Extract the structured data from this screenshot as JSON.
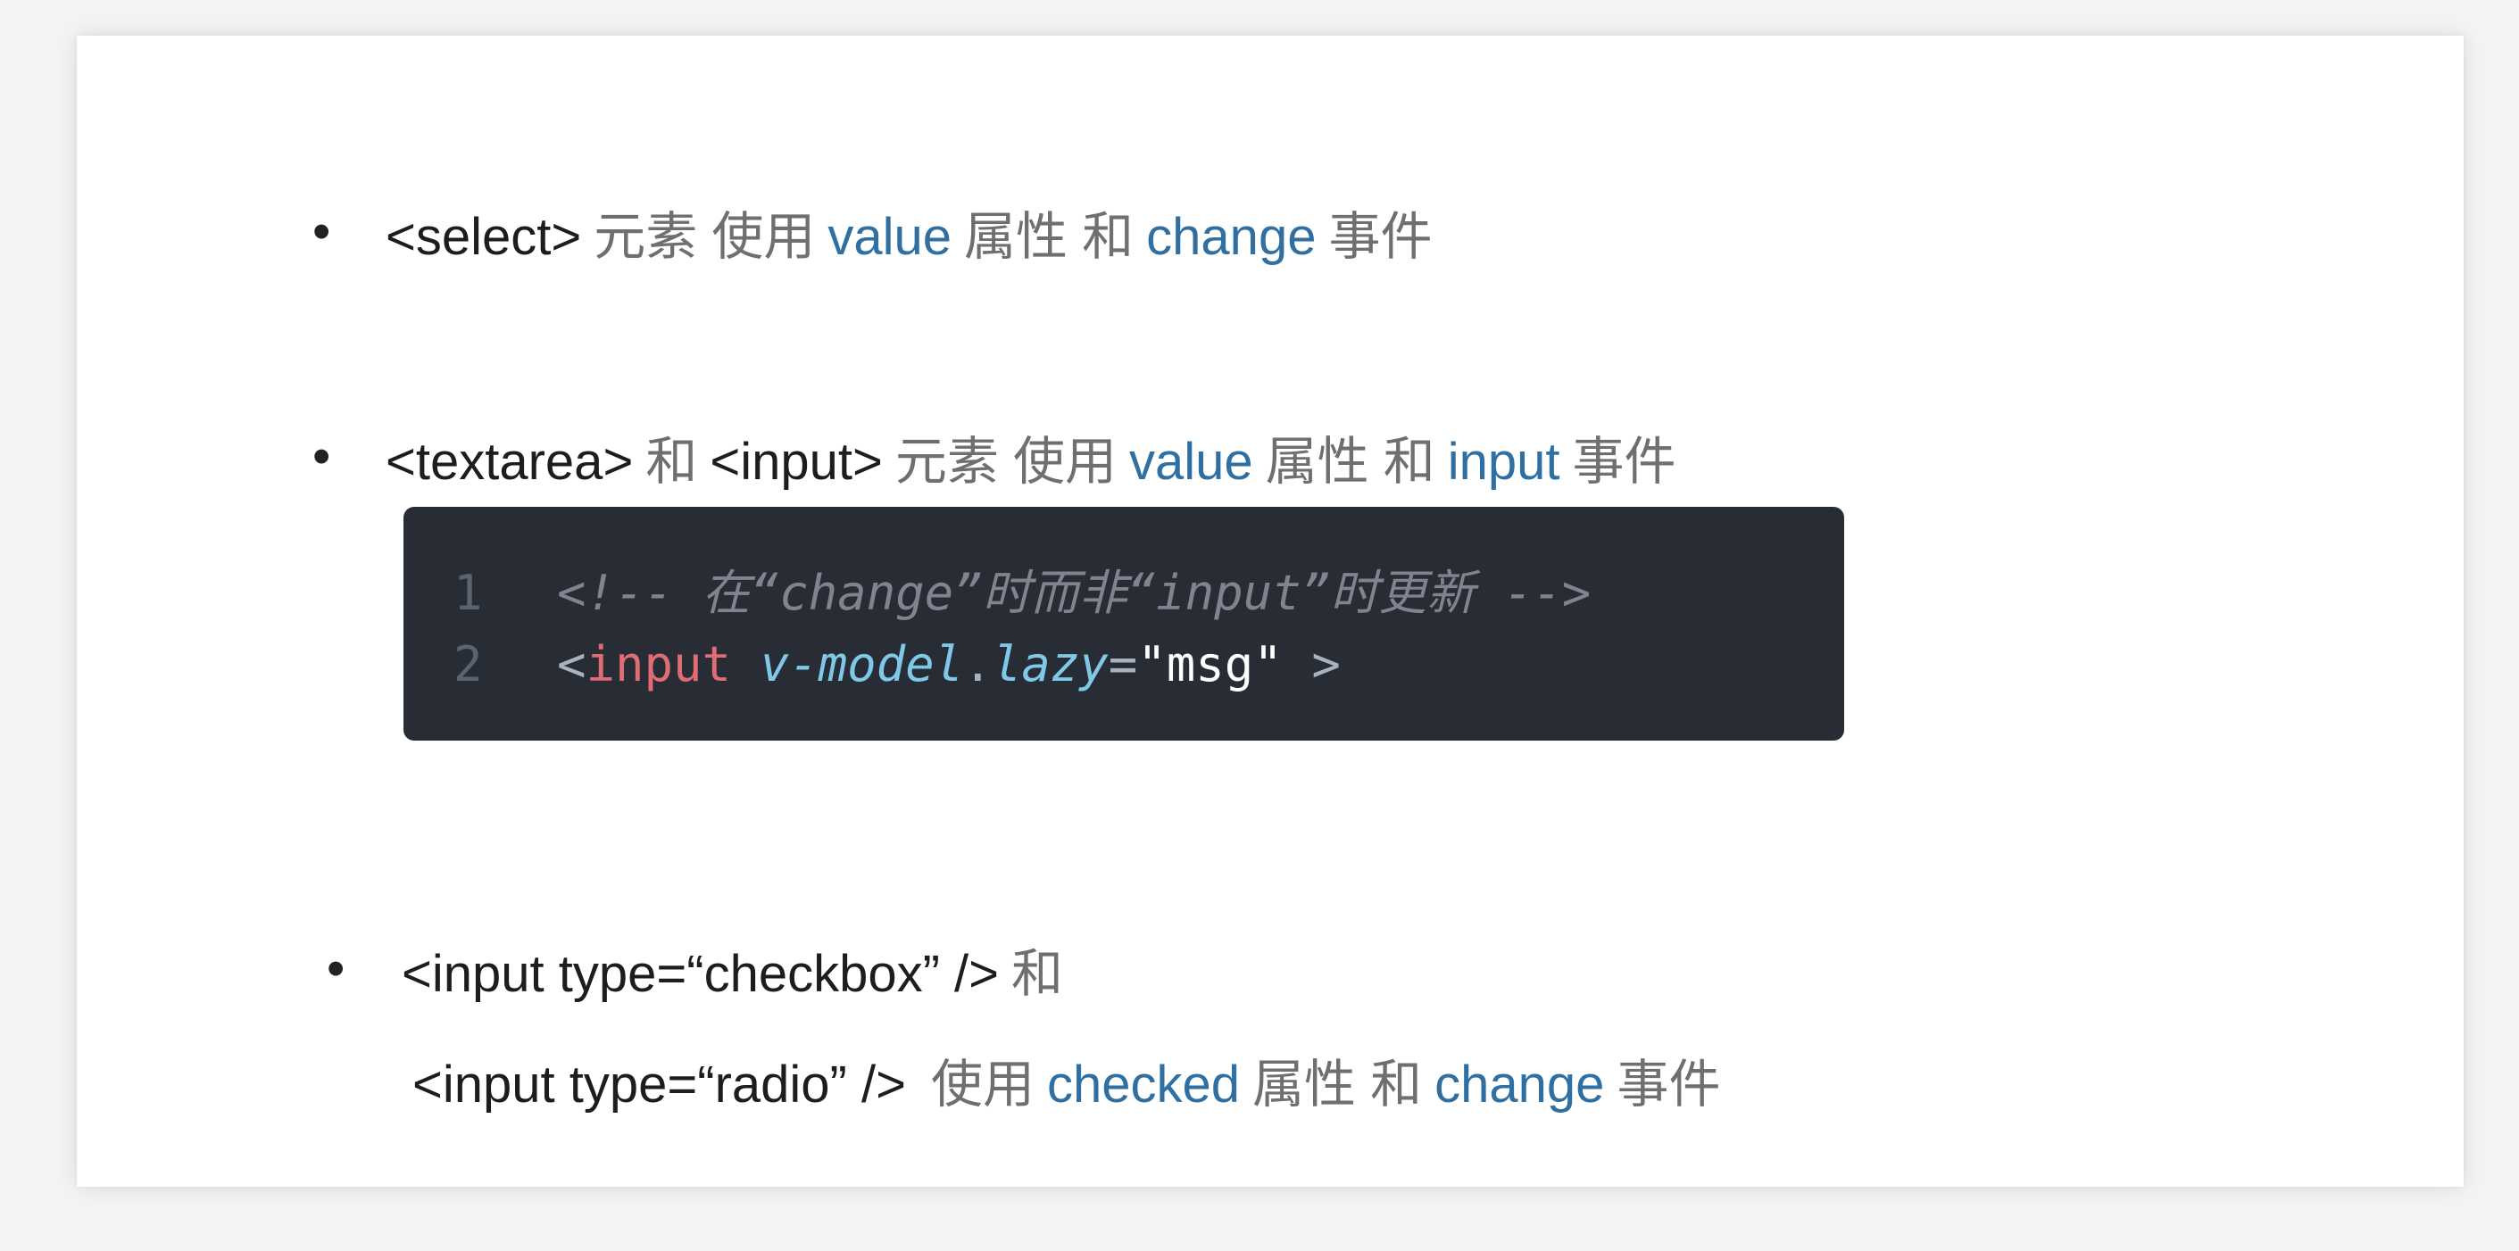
{
  "bullets": {
    "select": {
      "marker": "•",
      "tag": "<select>",
      "text1": "元素 使用",
      "kw1": "value",
      "text2": "属性 和",
      "kw2": "change",
      "text3": "事件"
    },
    "textarea": {
      "marker": "•",
      "tag1": "<textarea>",
      "text0": "和",
      "tag2": "<input>",
      "text1": "元素 使用",
      "kw1": "value",
      "text2": "属性 和",
      "kw2": "input",
      "text3": "事件"
    },
    "checkbox": {
      "marker": "•",
      "line1_tag": "<input type=“checkbox” />",
      "line1_text": "和",
      "line2_tag": "<input type=“radio” />",
      "line2_text1": "使用",
      "kw1": "checked",
      "line2_text2": "属性 和",
      "kw2": "change",
      "line2_text3": "事件"
    }
  },
  "code": {
    "line1": {
      "number": "1",
      "comment": "<!-- 在“change”时而非“input”时更新 -->"
    },
    "line2": {
      "number": "2",
      "open": "<",
      "tag": "input",
      "space": " ",
      "attr_name": "v-model",
      "dot": ".",
      "modifier": "lazy",
      "equals": "=",
      "value": "\"msg\"",
      "close": " >"
    }
  }
}
